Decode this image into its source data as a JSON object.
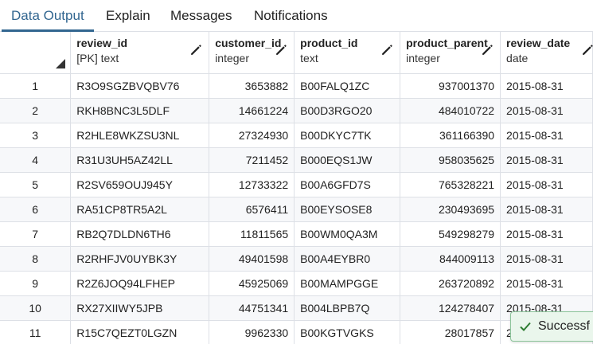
{
  "tabs": [
    {
      "label": "Data Output",
      "active": true
    },
    {
      "label": "Explain",
      "active": false
    },
    {
      "label": "Messages",
      "active": false
    },
    {
      "label": "Notifications",
      "active": false
    }
  ],
  "columns": [
    {
      "name": "review_id",
      "type": "[PK] text"
    },
    {
      "name": "customer_id",
      "type": "integer"
    },
    {
      "name": "product_id",
      "type": "text"
    },
    {
      "name": "product_parent",
      "type": "integer"
    },
    {
      "name": "review_date",
      "type": "date"
    }
  ],
  "rows": [
    {
      "n": "1",
      "review_id": "R3O9SGZBVQBV76",
      "customer_id": "3653882",
      "product_id": "B00FALQ1ZC",
      "product_parent": "937001370",
      "review_date": "2015-08-31"
    },
    {
      "n": "2",
      "review_id": "RKH8BNC3L5DLF",
      "customer_id": "14661224",
      "product_id": "B00D3RGO20",
      "product_parent": "484010722",
      "review_date": "2015-08-31"
    },
    {
      "n": "3",
      "review_id": "R2HLE8WKZSU3NL",
      "customer_id": "27324930",
      "product_id": "B00DKYC7TK",
      "product_parent": "361166390",
      "review_date": "2015-08-31"
    },
    {
      "n": "4",
      "review_id": "R31U3UH5AZ42LL",
      "customer_id": "7211452",
      "product_id": "B000EQS1JW",
      "product_parent": "958035625",
      "review_date": "2015-08-31"
    },
    {
      "n": "5",
      "review_id": "R2SV659OUJ945Y",
      "customer_id": "12733322",
      "product_id": "B00A6GFD7S",
      "product_parent": "765328221",
      "review_date": "2015-08-31"
    },
    {
      "n": "6",
      "review_id": "RA51CP8TR5A2L",
      "customer_id": "6576411",
      "product_id": "B00EYSOSE8",
      "product_parent": "230493695",
      "review_date": "2015-08-31"
    },
    {
      "n": "7",
      "review_id": "RB2Q7DLDN6TH6",
      "customer_id": "11811565",
      "product_id": "B00WM0QA3M",
      "product_parent": "549298279",
      "review_date": "2015-08-31"
    },
    {
      "n": "8",
      "review_id": "R2RHFJV0UYBK3Y",
      "customer_id": "49401598",
      "product_id": "B00A4EYBR0",
      "product_parent": "844009113",
      "review_date": "2015-08-31"
    },
    {
      "n": "9",
      "review_id": "R2Z6JOQ94LFHEP",
      "customer_id": "45925069",
      "product_id": "B00MAMPGGE",
      "product_parent": "263720892",
      "review_date": "2015-08-31"
    },
    {
      "n": "10",
      "review_id": "RX27XIIWY5JPB",
      "customer_id": "44751341",
      "product_id": "B004LBPB7Q",
      "product_parent": "124278407",
      "review_date": "2015-08-31"
    },
    {
      "n": "11",
      "review_id": "R15C7QEZT0LGZN",
      "customer_id": "9962330",
      "product_id": "B00KGTVGKS",
      "product_parent": "28017857",
      "review_date": "2015-08-31"
    }
  ],
  "toast": {
    "message": "Successf"
  },
  "colors": {
    "accent": "#326690",
    "success_bg": "#eaf6ec",
    "success_border": "#8cc49a",
    "success_check": "#2e7d32"
  }
}
